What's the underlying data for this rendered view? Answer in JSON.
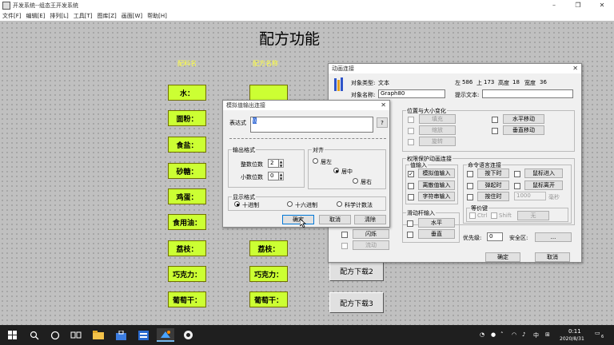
{
  "window": {
    "title": "开发系统--组态王开发系统",
    "minimize_glyph": "–",
    "restore_glyph": "❐",
    "close_glyph": "✕"
  },
  "menu": [
    "文件[F]",
    "编辑[E]",
    "排列[L]",
    "工具[T]",
    "图库[Z]",
    "画面[W]",
    "帮助[H]"
  ],
  "canvas": {
    "title": "配方功能",
    "col_ingredient": "配料名",
    "col_recipe": "配方名称",
    "ingredients": [
      "水：",
      "面粉：",
      "食盐：",
      "砂糖：",
      "鸡蛋：",
      "食用油：",
      "荔枝：",
      "巧克力：",
      "葡萄干："
    ],
    "recipe_visible": [
      "荔枝：",
      "巧克力：",
      "葡萄干："
    ],
    "download2": "配方下载2",
    "download3": "配方下载3"
  },
  "anim": {
    "title": "动画连接",
    "obj_type_label": "对象类型:",
    "obj_type_value": "文本",
    "left_label": "左",
    "left_value": "586",
    "top_label": "上",
    "top_value": "173",
    "height_label": "高度",
    "height_value": "18",
    "width_label": "宽度",
    "width_value": "36",
    "obj_name_label": "对象名称:",
    "obj_name_value": "Graph80",
    "tip_label": "提示文本:",
    "tip_value": "",
    "pos_group": "位置与大小变化",
    "fill": "填充",
    "scale": "缩放",
    "rotate": "旋转",
    "h_move": "水平移动",
    "v_move": "垂直移动",
    "permission_group": "权限保护动画连接",
    "value_input_group": "值输入",
    "analog_input": "模拟值输入",
    "discrete_input": "离散值输入",
    "string_input": "字符串输入",
    "cmd_group": "命令语言连接",
    "press": "按下时",
    "release": "弹起时",
    "hold": "按住时",
    "mouse_in": "鼠标进入",
    "mouse_out": "鼠标离开",
    "hold_ms": "1000",
    "ms_unit": "毫秒",
    "hotkey_group": "等价键",
    "ctrl": "Ctrl",
    "shift": "Shift",
    "none_key": "无",
    "slider_group": "滑动杆输入",
    "horizontal": "水平",
    "vertical": "垂直",
    "flash": "闪烁",
    "hide": "隐含",
    "flow": "流动",
    "priority_label": "优先级:",
    "priority_value": "0",
    "security_label": "安全区:",
    "ellipsis": "...",
    "ok": "确定",
    "cancel": "取消"
  },
  "analog": {
    "title": "模拟值输出连接",
    "expr_label": "表达式",
    "expr_value": "\\\\",
    "query_btn": "?",
    "format_group": "输出格式",
    "int_digits_label": "整数位数",
    "int_digits_value": "2",
    "dec_digits_label": "小数位数",
    "dec_digits_value": "0",
    "align_group": "对齐",
    "align_left": "居左",
    "align_center": "居中",
    "align_right": "居右",
    "display_group": "显示格式",
    "decimal": "十进制",
    "hex": "十六进制",
    "sci": "科学计数法",
    "ok": "确定",
    "cancel": "取消",
    "clear": "清除"
  },
  "taskbar": {
    "time": "0:11",
    "date": "2020/8/31",
    "ime": "中",
    "notification_count": "6"
  }
}
